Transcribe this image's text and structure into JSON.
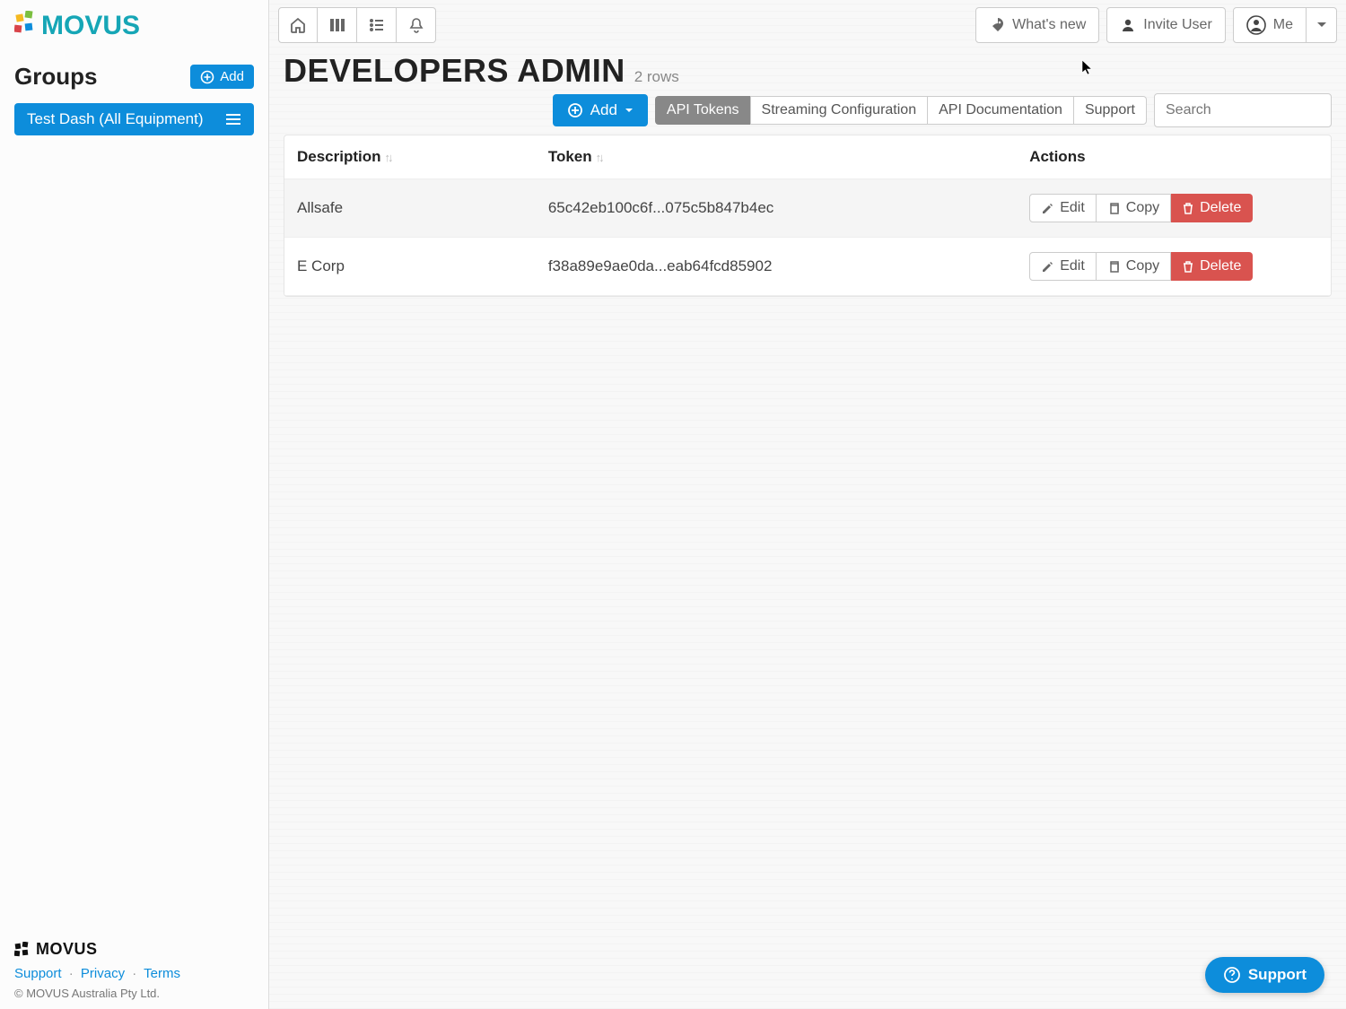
{
  "brand": {
    "name": "MOVUS"
  },
  "sidebar": {
    "groups_title": "Groups",
    "add_label": "Add",
    "items": [
      {
        "label": "Test Dash (All Equipment)"
      }
    ],
    "footer": {
      "brand": "MOVUS",
      "links": {
        "support": "Support",
        "privacy": "Privacy",
        "terms": "Terms"
      },
      "separator": "·",
      "copyright": "© MOVUS Australia Pty Ltd."
    }
  },
  "topbar": {
    "whats_new": "What's new",
    "invite_user": "Invite User",
    "me": "Me"
  },
  "page": {
    "title": "DEVELOPERS ADMIN",
    "row_count_text": "2 rows"
  },
  "toolbar": {
    "add_label": "Add",
    "tabs": {
      "api_tokens": "API Tokens",
      "streaming_config": "Streaming Configuration",
      "api_docs": "API Documentation",
      "support": "Support"
    },
    "search_placeholder": "Search"
  },
  "table": {
    "columns": {
      "description": "Description",
      "token": "Token",
      "actions": "Actions"
    },
    "actions": {
      "edit": "Edit",
      "copy": "Copy",
      "delete": "Delete"
    },
    "rows": [
      {
        "description": "Allsafe",
        "token": "65c42eb100c6f...075c5b847b4ec"
      },
      {
        "description": "E Corp",
        "token": "f38a89e9ae0da...eab64fcd85902"
      }
    ]
  },
  "support_bubble": {
    "label": "Support"
  }
}
